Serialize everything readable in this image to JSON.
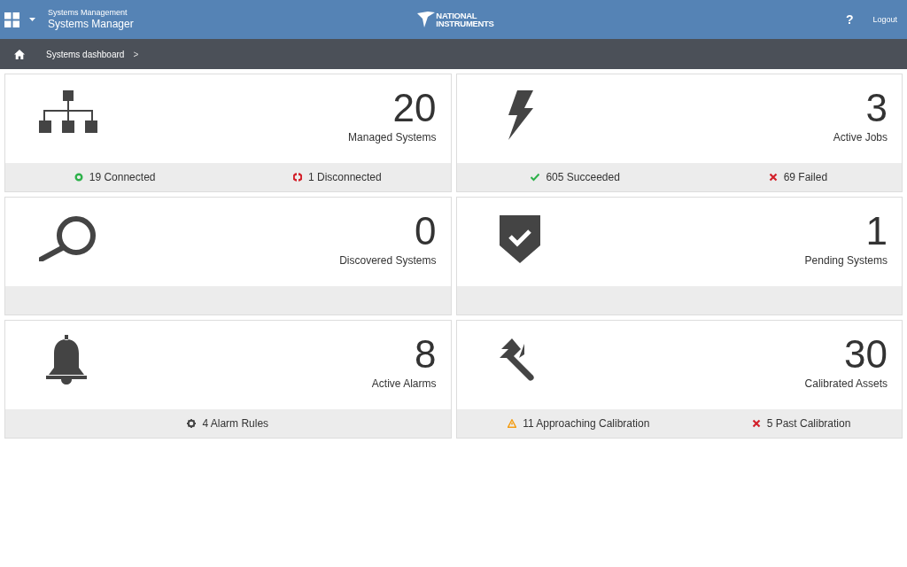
{
  "header": {
    "subtitle": "Systems Management",
    "title": "Systems Manager",
    "logo": [
      "NATIONAL",
      "INSTRUMENTS"
    ],
    "help": "?",
    "logout": "Logout"
  },
  "breadcrumb": {
    "items": [
      "Systems dashboard"
    ],
    "separator": ">"
  },
  "cards": [
    {
      "kind": "network",
      "value": "20",
      "label": "Managed Systems",
      "stats": [
        {
          "kind": "connected",
          "text": "19 Connected"
        },
        {
          "kind": "disconnected",
          "text": "1 Disconnected"
        }
      ]
    },
    {
      "kind": "bolt",
      "value": "3",
      "label": "Active Jobs",
      "stats": [
        {
          "kind": "success",
          "text": "605 Succeeded"
        },
        {
          "kind": "failure",
          "text": "69 Failed"
        }
      ]
    },
    {
      "kind": "search",
      "value": "0",
      "label": "Discovered Systems"
    },
    {
      "kind": "shield",
      "value": "1",
      "label": "Pending Systems"
    },
    {
      "kind": "bell",
      "value": "8",
      "label": "Active Alarms",
      "stats": [
        {
          "kind": "rules",
          "text": "4 Alarm Rules"
        }
      ]
    },
    {
      "kind": "caliper",
      "value": "30",
      "label": "Calibrated Assets",
      "stats": [
        {
          "kind": "warning",
          "text": "11 Approaching Calibration"
        },
        {
          "kind": "failure",
          "text": "5 Past Calibration"
        }
      ]
    }
  ]
}
